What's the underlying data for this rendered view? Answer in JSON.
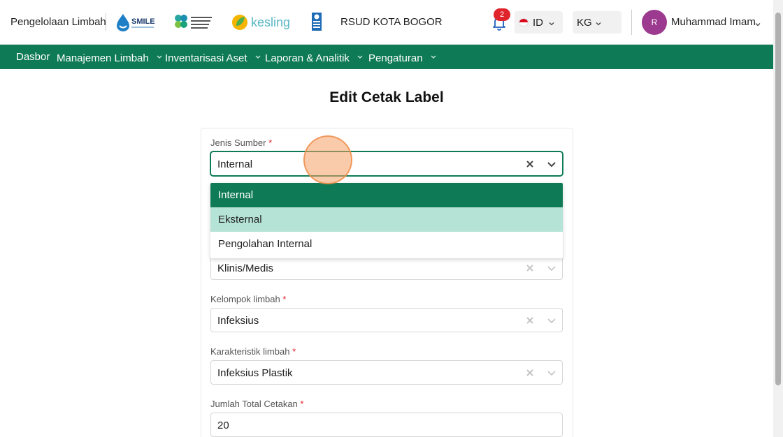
{
  "header": {
    "brand": "Pengelolaan Limbah",
    "logos": [
      "smile-logo",
      "kemenkes-logo",
      "kesling-logo",
      "undp-logo"
    ],
    "logo_texts": {
      "smile": "SMILE",
      "kesling": "kesling"
    },
    "organization": "RSUD KOTA BOGOR",
    "notification_count": "2",
    "language": "ID",
    "unit": "KG",
    "avatar_initial": "R",
    "user_name": "Muhammad Imam"
  },
  "nav": {
    "items": [
      {
        "label": "Dasbor",
        "has_dropdown": false
      },
      {
        "label": "Manajemen Limbah",
        "has_dropdown": true
      },
      {
        "label": "Inventarisasi Aset",
        "has_dropdown": true
      },
      {
        "label": "Laporan & Analitik",
        "has_dropdown": true
      },
      {
        "label": "Pengaturan",
        "has_dropdown": true
      }
    ]
  },
  "page": {
    "title": "Edit Cetak Label"
  },
  "form": {
    "jenis_sumber": {
      "label": "Jenis Sumber",
      "required": "*",
      "value": "Internal"
    },
    "kategori": {
      "value": "Klinis/Medis"
    },
    "kelompok": {
      "label": "Kelompok limbah",
      "required": "*",
      "value": "Infeksius"
    },
    "karakteristik": {
      "label": "Karakteristik limbah",
      "required": "*",
      "value": "Infeksius Plastik"
    },
    "jumlah": {
      "label": "Jumlah Total Cetakan",
      "required": "*",
      "value": "20"
    }
  },
  "dropdown": {
    "options": [
      {
        "label": "Internal",
        "state": "selected"
      },
      {
        "label": "Eksternal",
        "state": "hover"
      },
      {
        "label": "Pengolahan Internal",
        "state": "normal"
      }
    ]
  },
  "colors": {
    "primary": "#0f7b56",
    "option_hover": "#b5e3d5",
    "badge": "#e0242b",
    "avatar": "#9b3a8e"
  }
}
